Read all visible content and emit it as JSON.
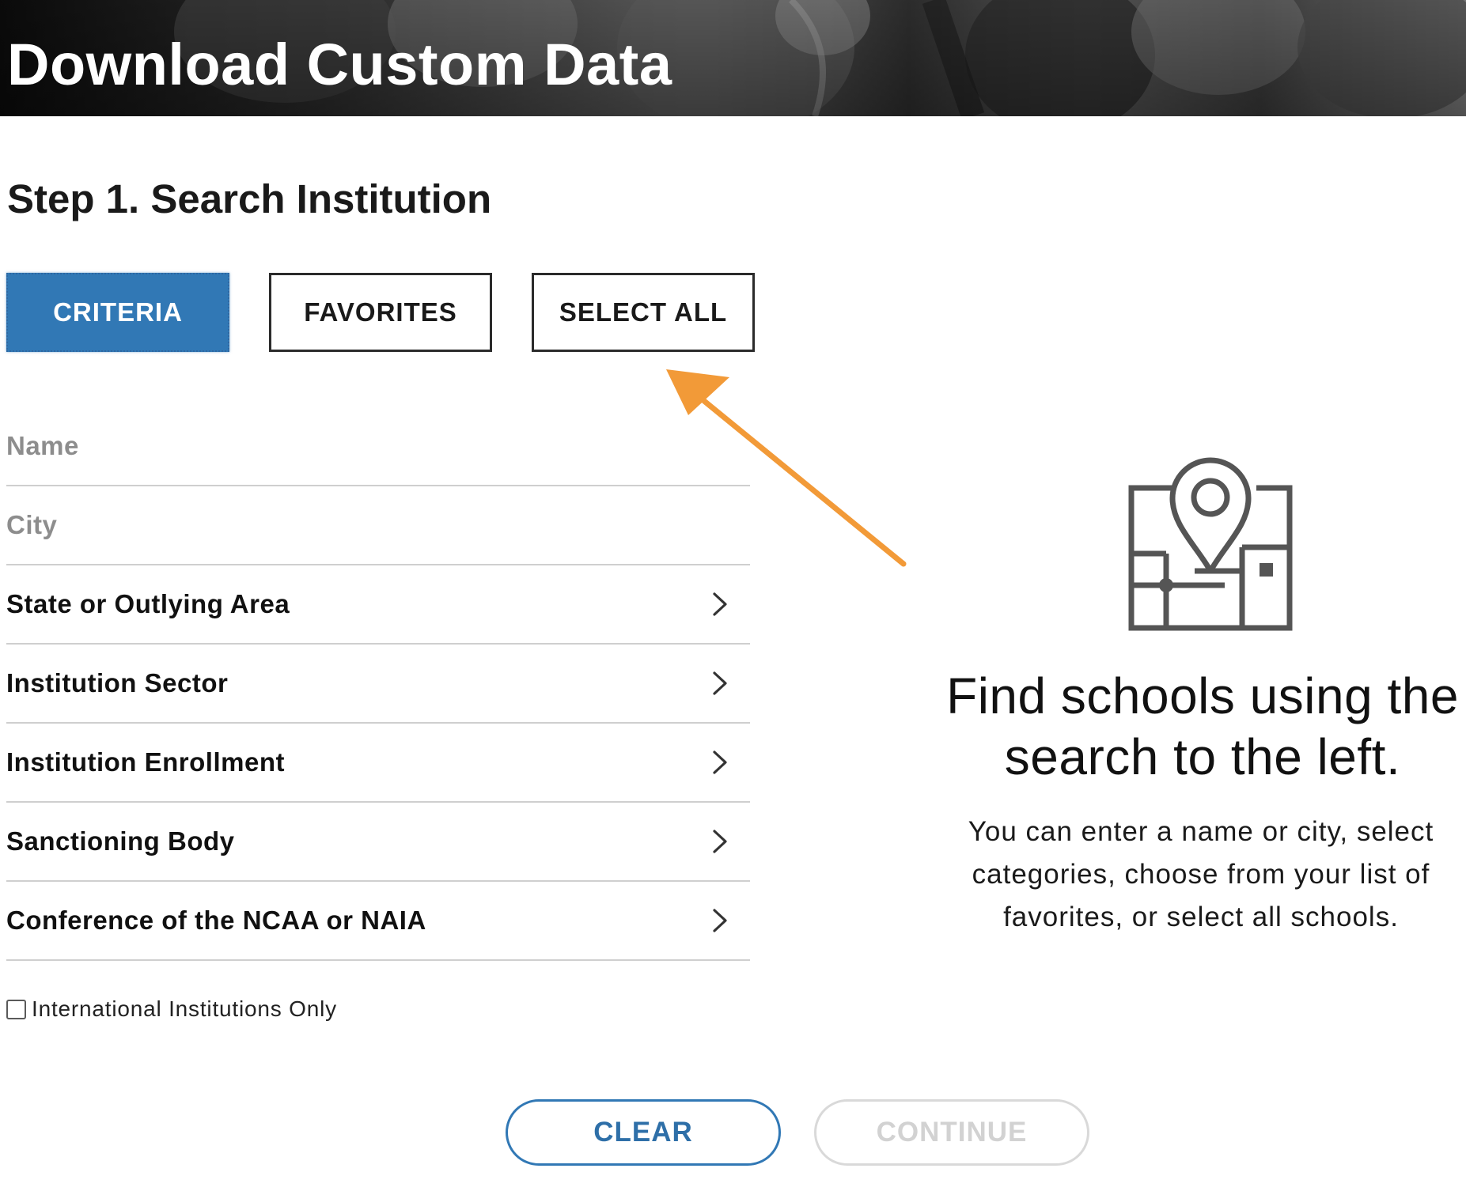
{
  "header": {
    "title": "Download Custom Data"
  },
  "step": {
    "title": "Step 1. Search Institution"
  },
  "tabs": [
    {
      "label": "CRITERIA",
      "active": true
    },
    {
      "label": "FAVORITES",
      "active": false
    },
    {
      "label": "SELECT ALL",
      "active": false
    }
  ],
  "annotation": {
    "arrow_color": "#F29A38",
    "points_to": "SELECT ALL"
  },
  "criteria": {
    "name_field": {
      "placeholder": "Name",
      "value": ""
    },
    "city_field": {
      "placeholder": "City",
      "value": ""
    },
    "expandable_rows": [
      {
        "label": "State or Outlying Area",
        "icon": "chevron-right-icon"
      },
      {
        "label": "Institution Sector",
        "icon": "chevron-right-icon"
      },
      {
        "label": "Institution Enrollment",
        "icon": "chevron-right-icon"
      },
      {
        "label": "Sanctioning Body",
        "icon": "chevron-right-icon"
      },
      {
        "label": "Conference of the NCAA or NAIA",
        "icon": "chevron-right-icon"
      }
    ],
    "international_checkbox": {
      "label": "International Institutions Only",
      "checked": false
    }
  },
  "hint": {
    "icon": "map-pin-icon",
    "title": "Find schools using the search to the left.",
    "body": "You can enter a name or city, select categories, choose from your list of favorites, or select all schools."
  },
  "actions": {
    "clear_label": "CLEAR",
    "continue_label": "CONTINUE",
    "continue_enabled": false
  },
  "colors": {
    "primary": "#3178B5",
    "disabled": "#D2D2D2",
    "accent_arrow": "#F29A38"
  }
}
